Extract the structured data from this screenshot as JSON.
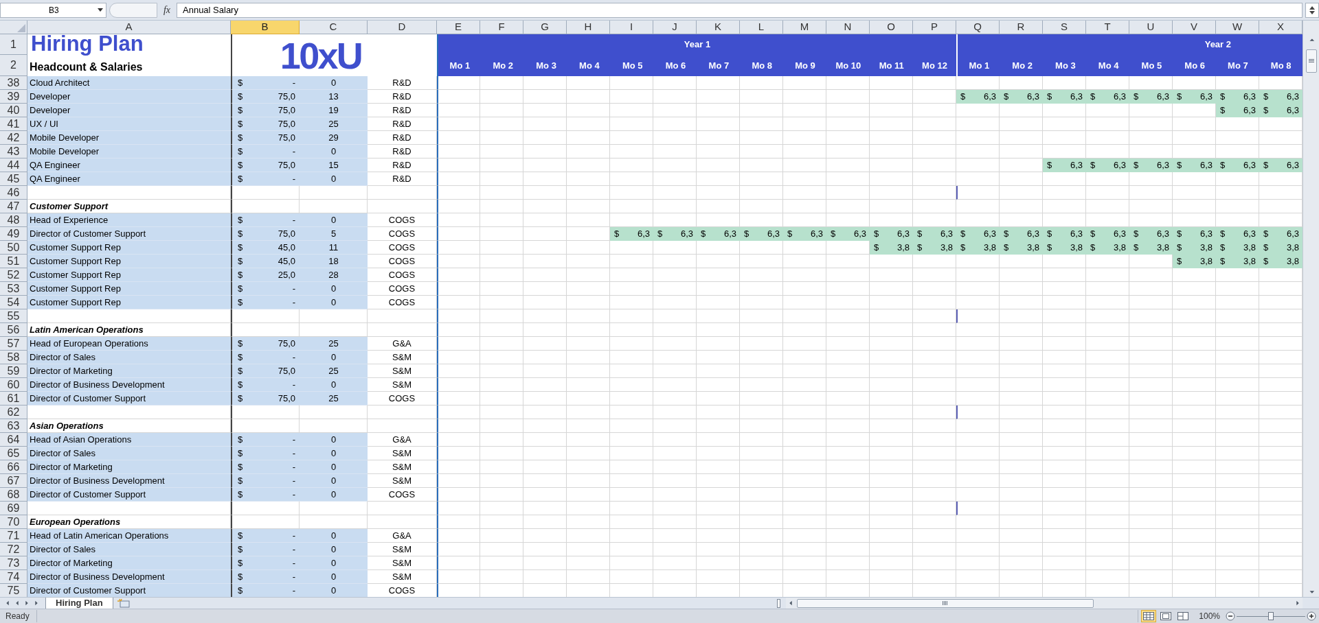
{
  "formula_bar": {
    "name_box": "B3",
    "function_label": "fx",
    "formula": "Annual Salary"
  },
  "columns": [
    {
      "label": "A",
      "selected": false
    },
    {
      "label": "B",
      "selected": true
    },
    {
      "label": "C",
      "selected": false
    },
    {
      "label": "D",
      "selected": false
    },
    {
      "label": "E",
      "selected": false
    },
    {
      "label": "F",
      "selected": false
    },
    {
      "label": "G",
      "selected": false
    },
    {
      "label": "H",
      "selected": false
    },
    {
      "label": "I",
      "selected": false
    },
    {
      "label": "J",
      "selected": false
    },
    {
      "label": "K",
      "selected": false
    },
    {
      "label": "L",
      "selected": false
    },
    {
      "label": "M",
      "selected": false
    },
    {
      "label": "N",
      "selected": false
    },
    {
      "label": "O",
      "selected": false
    },
    {
      "label": "P",
      "selected": false
    },
    {
      "label": "Q",
      "selected": false
    },
    {
      "label": "R",
      "selected": false
    },
    {
      "label": "S",
      "selected": false
    },
    {
      "label": "T",
      "selected": false
    },
    {
      "label": "U",
      "selected": false
    },
    {
      "label": "V",
      "selected": false
    },
    {
      "label": "W",
      "selected": false
    },
    {
      "label": "X",
      "selected": false
    }
  ],
  "header": {
    "row_numbers": [
      "1",
      "2"
    ],
    "title": "Hiring Plan",
    "subtitle": "Headcount & Salaries",
    "logo": "10xU",
    "years": [
      {
        "label": "Year 1",
        "months": [
          "Mo 1",
          "Mo 2",
          "Mo 3",
          "Mo 4",
          "Mo 5",
          "Mo 6",
          "Mo 7",
          "Mo 8",
          "Mo 9",
          "Mo 10",
          "Mo 11",
          "Mo 12"
        ]
      },
      {
        "label": "Year 2",
        "months": [
          "Mo 1",
          "Mo 2",
          "Mo 3",
          "Mo 4",
          "Mo 5",
          "Mo 6",
          "Mo 7",
          "Mo 8"
        ]
      }
    ]
  },
  "rows": [
    {
      "num": "38",
      "kind": "role",
      "name": "Cloud Architect",
      "currency": "$",
      "salary": "-",
      "month": "0",
      "dept": "R&D"
    },
    {
      "num": "39",
      "kind": "role",
      "name": "Developer",
      "currency": "$",
      "salary": "75,0",
      "month": "13",
      "dept": "R&D",
      "timeline": [
        {
          "kind": "empty"
        },
        {
          "kind": "empty"
        },
        {
          "kind": "empty"
        },
        {
          "kind": "empty"
        },
        {
          "kind": "empty"
        },
        {
          "kind": "empty"
        },
        {
          "kind": "empty"
        },
        {
          "kind": "empty"
        },
        {
          "kind": "empty"
        },
        {
          "kind": "empty"
        },
        {
          "kind": "empty"
        },
        {
          "kind": "empty"
        },
        {
          "kind": "salary",
          "currency": "$",
          "amount": "6,3"
        },
        {
          "kind": "salary",
          "currency": "$",
          "amount": "6,3"
        },
        {
          "kind": "salary",
          "currency": "$",
          "amount": "6,3"
        },
        {
          "kind": "salary",
          "currency": "$",
          "amount": "6,3"
        },
        {
          "kind": "salary",
          "currency": "$",
          "amount": "6,3"
        },
        {
          "kind": "salary",
          "currency": "$",
          "amount": "6,3"
        },
        {
          "kind": "salary",
          "currency": "$",
          "amount": "6,3"
        },
        {
          "kind": "salary",
          "currency": "$",
          "amount": "6,3"
        }
      ]
    },
    {
      "num": "40",
      "kind": "role",
      "name": "Developer",
      "currency": "$",
      "salary": "75,0",
      "month": "19",
      "dept": "R&D",
      "timeline": [
        {
          "kind": "empty"
        },
        {
          "kind": "empty"
        },
        {
          "kind": "empty"
        },
        {
          "kind": "empty"
        },
        {
          "kind": "empty"
        },
        {
          "kind": "empty"
        },
        {
          "kind": "empty"
        },
        {
          "kind": "empty"
        },
        {
          "kind": "empty"
        },
        {
          "kind": "empty"
        },
        {
          "kind": "empty"
        },
        {
          "kind": "empty"
        },
        {
          "kind": "empty"
        },
        {
          "kind": "empty"
        },
        {
          "kind": "empty"
        },
        {
          "kind": "empty"
        },
        {
          "kind": "empty"
        },
        {
          "kind": "empty"
        },
        {
          "kind": "salary",
          "currency": "$",
          "amount": "6,3"
        },
        {
          "kind": "salary",
          "currency": "$",
          "amount": "6,3"
        }
      ]
    },
    {
      "num": "41",
      "kind": "role",
      "name": "UX / UI",
      "currency": "$",
      "salary": "75,0",
      "month": "25",
      "dept": "R&D"
    },
    {
      "num": "42",
      "kind": "role",
      "name": "Mobile Developer",
      "currency": "$",
      "salary": "75,0",
      "month": "29",
      "dept": "R&D"
    },
    {
      "num": "43",
      "kind": "role",
      "name": "Mobile Developer",
      "currency": "$",
      "salary": "-",
      "month": "0",
      "dept": "R&D"
    },
    {
      "num": "44",
      "kind": "role",
      "name": "QA Engineer",
      "currency": "$",
      "salary": "75,0",
      "month": "15",
      "dept": "R&D",
      "timeline": [
        {
          "kind": "empty"
        },
        {
          "kind": "empty"
        },
        {
          "kind": "empty"
        },
        {
          "kind": "empty"
        },
        {
          "kind": "empty"
        },
        {
          "kind": "empty"
        },
        {
          "kind": "empty"
        },
        {
          "kind": "empty"
        },
        {
          "kind": "empty"
        },
        {
          "kind": "empty"
        },
        {
          "kind": "empty"
        },
        {
          "kind": "empty"
        },
        {
          "kind": "empty"
        },
        {
          "kind": "empty"
        },
        {
          "kind": "salary",
          "currency": "$",
          "amount": "6,3"
        },
        {
          "kind": "salary",
          "currency": "$",
          "amount": "6,3"
        },
        {
          "kind": "salary",
          "currency": "$",
          "amount": "6,3"
        },
        {
          "kind": "salary",
          "currency": "$",
          "amount": "6,3"
        },
        {
          "kind": "salary",
          "currency": "$",
          "amount": "6,3"
        },
        {
          "kind": "salary",
          "currency": "$",
          "amount": "6,3"
        }
      ]
    },
    {
      "num": "45",
      "kind": "role",
      "name": "QA Engineer",
      "currency": "$",
      "salary": "-",
      "month": "0",
      "dept": "R&D"
    },
    {
      "num": "46",
      "kind": "blank"
    },
    {
      "num": "47",
      "kind": "section",
      "name": "Customer Support"
    },
    {
      "num": "48",
      "kind": "role",
      "name": "Head of Experience",
      "currency": "$",
      "salary": "-",
      "month": "0",
      "dept": "COGS"
    },
    {
      "num": "49",
      "kind": "role",
      "name": "Director of Customer Support",
      "currency": "$",
      "salary": "75,0",
      "month": "5",
      "dept": "COGS",
      "timeline": [
        {
          "kind": "empty"
        },
        {
          "kind": "empty"
        },
        {
          "kind": "empty"
        },
        {
          "kind": "empty"
        },
        {
          "kind": "salary",
          "currency": "$",
          "amount": "6,3"
        },
        {
          "kind": "salary",
          "currency": "$",
          "amount": "6,3"
        },
        {
          "kind": "salary",
          "currency": "$",
          "amount": "6,3"
        },
        {
          "kind": "salary",
          "currency": "$",
          "amount": "6,3"
        },
        {
          "kind": "salary",
          "currency": "$",
          "amount": "6,3"
        },
        {
          "kind": "salary",
          "currency": "$",
          "amount": "6,3"
        },
        {
          "kind": "salary",
          "currency": "$",
          "amount": "6,3"
        },
        {
          "kind": "salary",
          "currency": "$",
          "amount": "6,3"
        },
        {
          "kind": "salary",
          "currency": "$",
          "amount": "6,3"
        },
        {
          "kind": "salary",
          "currency": "$",
          "amount": "6,3"
        },
        {
          "kind": "salary",
          "currency": "$",
          "amount": "6,3"
        },
        {
          "kind": "salary",
          "currency": "$",
          "amount": "6,3"
        },
        {
          "kind": "salary",
          "currency": "$",
          "amount": "6,3"
        },
        {
          "kind": "salary",
          "currency": "$",
          "amount": "6,3"
        },
        {
          "kind": "salary",
          "currency": "$",
          "amount": "6,3"
        },
        {
          "kind": "salary",
          "currency": "$",
          "amount": "6,3"
        }
      ]
    },
    {
      "num": "50",
      "kind": "role",
      "name": "Customer Support Rep",
      "currency": "$",
      "salary": "45,0",
      "month": "11",
      "dept": "COGS",
      "timeline": [
        {
          "kind": "empty"
        },
        {
          "kind": "empty"
        },
        {
          "kind": "empty"
        },
        {
          "kind": "empty"
        },
        {
          "kind": "empty"
        },
        {
          "kind": "empty"
        },
        {
          "kind": "empty"
        },
        {
          "kind": "empty"
        },
        {
          "kind": "empty"
        },
        {
          "kind": "empty"
        },
        {
          "kind": "salary",
          "currency": "$",
          "amount": "3,8"
        },
        {
          "kind": "salary",
          "currency": "$",
          "amount": "3,8"
        },
        {
          "kind": "salary",
          "currency": "$",
          "amount": "3,8"
        },
        {
          "kind": "salary",
          "currency": "$",
          "amount": "3,8"
        },
        {
          "kind": "salary",
          "currency": "$",
          "amount": "3,8"
        },
        {
          "kind": "salary",
          "currency": "$",
          "amount": "3,8"
        },
        {
          "kind": "salary",
          "currency": "$",
          "amount": "3,8"
        },
        {
          "kind": "salary",
          "currency": "$",
          "amount": "3,8"
        },
        {
          "kind": "salary",
          "currency": "$",
          "amount": "3,8"
        },
        {
          "kind": "salary",
          "currency": "$",
          "amount": "3,8"
        }
      ]
    },
    {
      "num": "51",
      "kind": "role",
      "name": "Customer Support Rep",
      "currency": "$",
      "salary": "45,0",
      "month": "18",
      "dept": "COGS",
      "timeline": [
        {
          "kind": "empty"
        },
        {
          "kind": "empty"
        },
        {
          "kind": "empty"
        },
        {
          "kind": "empty"
        },
        {
          "kind": "empty"
        },
        {
          "kind": "empty"
        },
        {
          "kind": "empty"
        },
        {
          "kind": "empty"
        },
        {
          "kind": "empty"
        },
        {
          "kind": "empty"
        },
        {
          "kind": "empty"
        },
        {
          "kind": "empty"
        },
        {
          "kind": "empty"
        },
        {
          "kind": "empty"
        },
        {
          "kind": "empty"
        },
        {
          "kind": "empty"
        },
        {
          "kind": "empty"
        },
        {
          "kind": "salary",
          "currency": "$",
          "amount": "3,8"
        },
        {
          "kind": "salary",
          "currency": "$",
          "amount": "3,8"
        },
        {
          "kind": "salary",
          "currency": "$",
          "amount": "3,8"
        }
      ]
    },
    {
      "num": "52",
      "kind": "role",
      "name": "Customer Support Rep",
      "currency": "$",
      "salary": "25,0",
      "month": "28",
      "dept": "COGS"
    },
    {
      "num": "53",
      "kind": "role",
      "name": "Customer Support Rep",
      "currency": "$",
      "salary": "-",
      "month": "0",
      "dept": "COGS"
    },
    {
      "num": "54",
      "kind": "role",
      "name": "Customer Support Rep",
      "currency": "$",
      "salary": "-",
      "month": "0",
      "dept": "COGS"
    },
    {
      "num": "55",
      "kind": "blank"
    },
    {
      "num": "56",
      "kind": "section",
      "name": "Latin American Operations"
    },
    {
      "num": "57",
      "kind": "role",
      "name": "Head of European Operations",
      "currency": "$",
      "salary": "75,0",
      "month": "25",
      "dept": "G&A"
    },
    {
      "num": "58",
      "kind": "role",
      "name": "Director of Sales",
      "currency": "$",
      "salary": "-",
      "month": "0",
      "dept": "S&M"
    },
    {
      "num": "59",
      "kind": "role",
      "name": "Director of Marketing",
      "currency": "$",
      "salary": "75,0",
      "month": "25",
      "dept": "S&M"
    },
    {
      "num": "60",
      "kind": "role",
      "name": "Director of Business Development",
      "currency": "$",
      "salary": "-",
      "month": "0",
      "dept": "S&M"
    },
    {
      "num": "61",
      "kind": "role",
      "name": "Director of Customer Support",
      "currency": "$",
      "salary": "75,0",
      "month": "25",
      "dept": "COGS"
    },
    {
      "num": "62",
      "kind": "blank"
    },
    {
      "num": "63",
      "kind": "section",
      "name": "Asian Operations"
    },
    {
      "num": "64",
      "kind": "role",
      "name": "Head of Asian Operations",
      "currency": "$",
      "salary": "-",
      "month": "0",
      "dept": "G&A"
    },
    {
      "num": "65",
      "kind": "role",
      "name": "Director of Sales",
      "currency": "$",
      "salary": "-",
      "month": "0",
      "dept": "S&M"
    },
    {
      "num": "66",
      "kind": "role",
      "name": "Director of Marketing",
      "currency": "$",
      "salary": "-",
      "month": "0",
      "dept": "S&M"
    },
    {
      "num": "67",
      "kind": "role",
      "name": "Director of Business Development",
      "currency": "$",
      "salary": "-",
      "month": "0",
      "dept": "S&M"
    },
    {
      "num": "68",
      "kind": "role",
      "name": "Director of Customer Support",
      "currency": "$",
      "salary": "-",
      "month": "0",
      "dept": "COGS"
    },
    {
      "num": "69",
      "kind": "blank"
    },
    {
      "num": "70",
      "kind": "section",
      "name": "European Operations"
    },
    {
      "num": "71",
      "kind": "role",
      "name": "Head of Latin American Operations",
      "currency": "$",
      "salary": "-",
      "month": "0",
      "dept": "G&A"
    },
    {
      "num": "72",
      "kind": "role",
      "name": "Director of Sales",
      "currency": "$",
      "salary": "-",
      "month": "0",
      "dept": "S&M"
    },
    {
      "num": "73",
      "kind": "role",
      "name": "Director of Marketing",
      "currency": "$",
      "salary": "-",
      "month": "0",
      "dept": "S&M"
    },
    {
      "num": "74",
      "kind": "role",
      "name": "Director of Business Development",
      "currency": "$",
      "salary": "-",
      "month": "0",
      "dept": "S&M"
    },
    {
      "num": "75",
      "kind": "role",
      "name": "Director of Customer Support",
      "currency": "$",
      "salary": "-",
      "month": "0",
      "dept": "COGS"
    }
  ],
  "sheet_tabs": [
    {
      "label": "Hiring Plan",
      "selected": true
    }
  ],
  "status_bar": {
    "status": "Ready",
    "view_buttons": [
      {
        "kind": "normal",
        "selected": true
      },
      {
        "kind": "page-layout",
        "selected": false
      },
      {
        "kind": "page-break",
        "selected": false
      }
    ],
    "zoom": "100%",
    "zoom_slider": {
      "level": 0.5
    }
  }
}
